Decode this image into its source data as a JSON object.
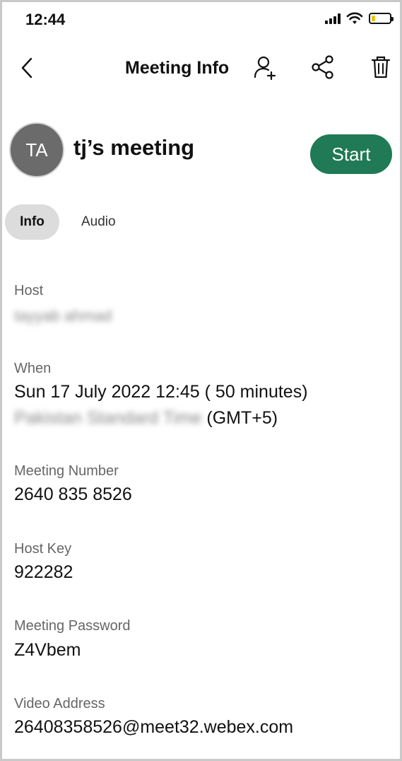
{
  "status_bar": {
    "time": "12:44",
    "icons": [
      "signal-icon",
      "wifi-icon",
      "battery-icon"
    ],
    "battery_color": "#f2c200"
  },
  "nav": {
    "title": "Meeting Info",
    "icons": [
      "back-icon",
      "add-person-icon",
      "share-icon",
      "trash-icon"
    ]
  },
  "meeting": {
    "avatar_initials": "TA",
    "title": "tj’s meeting",
    "start_label": "Start",
    "start_color": "#1f7a55"
  },
  "tabs": {
    "info": "Info",
    "audio": "Audio"
  },
  "fields": {
    "host": {
      "label": "Host",
      "value": "tayyab ahmad"
    },
    "when": {
      "label": "When",
      "datetime": "Sun 17 July 2022 12:45 ( 50 minutes)",
      "timezone_name": "Pakistan Standard Time",
      "timezone_offset": "(GMT+5)"
    },
    "meeting_number": {
      "label": "Meeting Number",
      "value": "2640 835 8526"
    },
    "host_key": {
      "label": "Host Key",
      "value": "922282"
    },
    "meeting_password": {
      "label": "Meeting Password",
      "value": "Z4Vbem"
    },
    "video_address": {
      "label": "Video Address",
      "value": "26408358526@meet32.webex.com"
    }
  }
}
